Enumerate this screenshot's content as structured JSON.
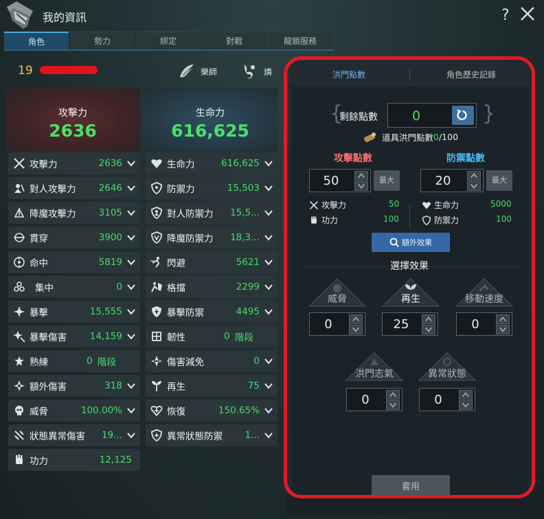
{
  "window": {
    "title": "我的資訊",
    "help": "?",
    "close_icon": "close-icon"
  },
  "tabs": [
    {
      "label": "角色",
      "active": true
    },
    {
      "label": "勢力",
      "active": false
    },
    {
      "label": "綁定",
      "active": false
    },
    {
      "label": "對戰",
      "active": false
    },
    {
      "label": "龍鎖服務",
      "active": false
    }
  ],
  "character": {
    "level": "19",
    "class1": {
      "label": "樂師",
      "icon": "musician-class-icon"
    },
    "class2": {
      "label": "燐",
      "icon": "race-lyn-icon"
    }
  },
  "attack_header": {
    "label": "攻擊力",
    "value": "2636"
  },
  "hp_header": {
    "label": "生命力",
    "value": "616,625"
  },
  "left_stats": [
    {
      "name": "攻擊力",
      "value": "2636",
      "icon": "crossed-swords-icon"
    },
    {
      "name": "對人攻擊力",
      "value": "2646",
      "icon": "pvp-attack-icon"
    },
    {
      "name": "降魔攻擊力",
      "value": "3105",
      "icon": "demon-attack-icon"
    },
    {
      "name": "貫穿",
      "value": "3900",
      "icon": "pierce-icon"
    },
    {
      "name": "命中",
      "value": "5819",
      "icon": "crosshair-icon"
    },
    {
      "name": "集中",
      "value": "0",
      "icon": "focus-icon"
    },
    {
      "name": "暴擊",
      "value": "15,555",
      "icon": "critical-icon"
    },
    {
      "name": "暴擊傷害",
      "value": "14,159",
      "icon": "crit-damage-icon"
    },
    {
      "name": "熟練",
      "value": "0",
      "stage": "階段",
      "icon": "mastery-icon"
    },
    {
      "name": "額外傷害",
      "value": "318",
      "icon": "extra-damage-icon"
    },
    {
      "name": "威脅",
      "value": "100.00%",
      "icon": "skull-icon"
    },
    {
      "name": "狀態異常傷害",
      "value": "19...",
      "icon": "status-damage-icon"
    },
    {
      "name": "功力",
      "value": "12,125",
      "icon": "power-fist-icon"
    }
  ],
  "right_stats": [
    {
      "name": "生命力",
      "value": "616,625",
      "icon": "heart-icon"
    },
    {
      "name": "防禦力",
      "value": "15,503",
      "icon": "shield-icon"
    },
    {
      "name": "對人防禦力",
      "value": "15,5...",
      "icon": "pvp-defense-icon"
    },
    {
      "name": "降魔防禦力",
      "value": "18,3...",
      "icon": "demon-defense-icon"
    },
    {
      "name": "閃避",
      "value": "5621",
      "icon": "evade-icon"
    },
    {
      "name": "格擋",
      "value": "2299",
      "icon": "block-icon"
    },
    {
      "name": "暴擊防禦",
      "value": "4495",
      "icon": "crit-defense-icon"
    },
    {
      "name": "韌性",
      "value": "0",
      "stage": "階段",
      "icon": "toughness-icon"
    },
    {
      "name": "傷害減免",
      "value": "0",
      "icon": "damage-reduce-icon"
    },
    {
      "name": "再生",
      "value": "75",
      "icon": "sprout-icon"
    },
    {
      "name": "恢復",
      "value": "150.65%",
      "icon": "recovery-heart-icon"
    },
    {
      "name": "異常狀態防禦",
      "value": "1...",
      "icon": "status-defense-icon"
    }
  ],
  "panel": {
    "tab_points": "洪門點數",
    "tab_history": "角色歷史記錄",
    "remain_label": "剩餘點數",
    "remain_value": "0",
    "item_label": "道具洪門點數",
    "item_current": "0",
    "item_total": "/100",
    "attack_title": "攻擊點數",
    "defense_title": "防禦點數",
    "attack_points": "50",
    "defense_points": "20",
    "max_label": "最大",
    "atk_stat1_label": "攻擊力",
    "atk_stat1_value": "50",
    "atk_stat2_label": "功力",
    "atk_stat2_value": "100",
    "def_stat1_label": "生命力",
    "def_stat1_value": "5000",
    "def_stat2_label": "防禦力",
    "def_stat2_value": "100",
    "extra_button": "額外效果",
    "select_title": "選擇效果",
    "effects": [
      {
        "label": "威脅",
        "value": "0",
        "active": false
      },
      {
        "label": "再生",
        "value": "25",
        "active": true
      },
      {
        "label": "移動速度",
        "value": "0",
        "active": false
      },
      {
        "label": "洪門志氣",
        "value": "0",
        "active": false
      },
      {
        "label": "異常狀態",
        "value": "0",
        "active": false
      }
    ],
    "apply_button": "套用"
  },
  "colors": {
    "green_value": "#4ad96b",
    "attack_red": "#ff6a6a",
    "defense_blue": "#48b8f0",
    "highlight_frame": "#e11a24",
    "level_gold": "#f0c060"
  }
}
